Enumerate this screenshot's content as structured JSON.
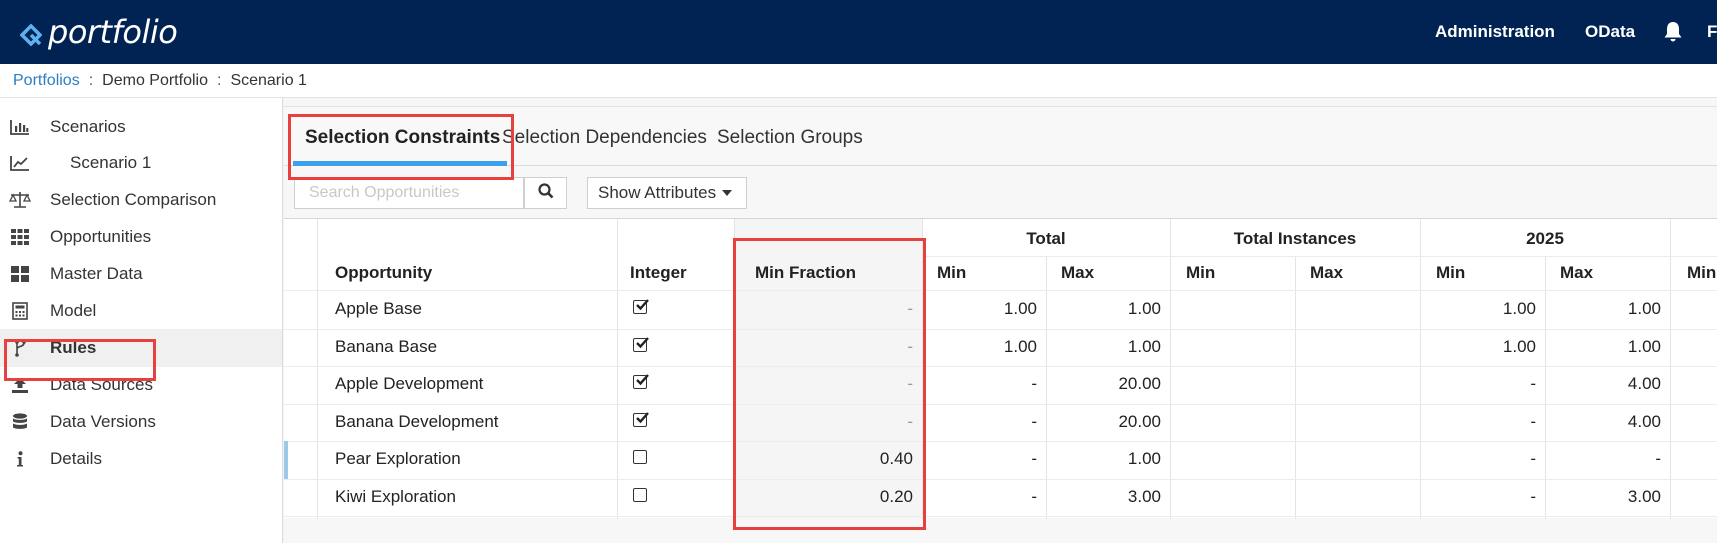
{
  "app": {
    "brand": "portfolio"
  },
  "topnav": {
    "admin_label": "Administration",
    "odata_label": "OData",
    "user_initial": "F"
  },
  "breadcrumb": {
    "root": "Portfolios",
    "portfolio": "Demo Portfolio",
    "scenario": "Scenario 1",
    "separator": ":"
  },
  "sidebar": {
    "items": [
      {
        "label": "Scenarios",
        "icon": "bar-chart-icon"
      },
      {
        "label": "Scenario 1",
        "icon": "line-chart-icon"
      },
      {
        "label": "Selection Comparison",
        "icon": "scale-icon"
      },
      {
        "label": "Opportunities",
        "icon": "grid-icon"
      },
      {
        "label": "Master Data",
        "icon": "tiles-icon"
      },
      {
        "label": "Model",
        "icon": "calculator-icon"
      },
      {
        "label": "Rules",
        "icon": "branch-icon"
      },
      {
        "label": "Data Sources",
        "icon": "upload-icon"
      },
      {
        "label": "Data Versions",
        "icon": "database-icon"
      },
      {
        "label": "Details",
        "icon": "info-icon"
      }
    ],
    "active": "Rules"
  },
  "tabs": [
    {
      "label": "Selection Constraints",
      "active": true
    },
    {
      "label": "Selection Dependencies",
      "active": false
    },
    {
      "label": "Selection Groups",
      "active": false
    }
  ],
  "toolbar": {
    "search_placeholder": "Search Opportunities",
    "attributes_label": "Show Attributes"
  },
  "table": {
    "group_headers": {
      "total": "Total",
      "total_instances": "Total Instances",
      "year": "2025"
    },
    "headers": {
      "opportunity": "Opportunity",
      "integer": "Integer",
      "min_fraction": "Min Fraction",
      "min": "Min",
      "max": "Max"
    },
    "rows": [
      {
        "opportunity": "Apple Base",
        "integer": true,
        "min_fraction": "-",
        "total_min": "1.00",
        "total_max": "1.00",
        "inst_min": "",
        "inst_max": "",
        "y_min": "1.00",
        "y_max": "1.00"
      },
      {
        "opportunity": "Banana Base",
        "integer": true,
        "min_fraction": "-",
        "total_min": "1.00",
        "total_max": "1.00",
        "inst_min": "",
        "inst_max": "",
        "y_min": "1.00",
        "y_max": "1.00"
      },
      {
        "opportunity": "Apple Development",
        "integer": true,
        "min_fraction": "-",
        "total_min": "-",
        "total_max": "20.00",
        "inst_min": "",
        "inst_max": "",
        "y_min": "-",
        "y_max": "4.00"
      },
      {
        "opportunity": "Banana Development",
        "integer": true,
        "min_fraction": "-",
        "total_min": "-",
        "total_max": "20.00",
        "inst_min": "",
        "inst_max": "",
        "y_min": "-",
        "y_max": "4.00"
      },
      {
        "opportunity": "Pear Exploration",
        "integer": false,
        "min_fraction": "0.40",
        "total_min": "-",
        "total_max": "1.00",
        "inst_min": "",
        "inst_max": "",
        "y_min": "-",
        "y_max": "-"
      },
      {
        "opportunity": "Kiwi Exploration",
        "integer": false,
        "min_fraction": "0.20",
        "total_min": "-",
        "total_max": "3.00",
        "inst_min": "",
        "inst_max": "",
        "y_min": "-",
        "y_max": "3.00"
      }
    ]
  },
  "colors": {
    "header_bg": "#002353",
    "link": "#2b7ec4",
    "tab_underline": "#3ea0ea",
    "highlight": "#e8403e"
  }
}
